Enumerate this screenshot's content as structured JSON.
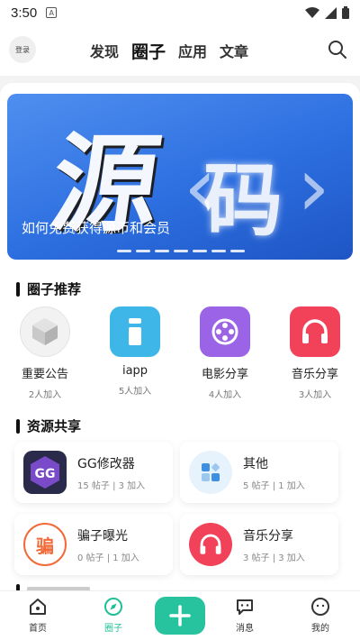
{
  "status": {
    "time": "3:50"
  },
  "header": {
    "login_label": "登录",
    "tabs": [
      {
        "label": "发现"
      },
      {
        "label": "圈子"
      },
      {
        "label": "应用"
      },
      {
        "label": "文章"
      }
    ],
    "active_tab": "圈子"
  },
  "banner": {
    "caption": "如何免费获得源币和会员",
    "art_text_1": "源",
    "art_text_2": "码",
    "dots": 7
  },
  "recommend": {
    "title": "圈子推荐",
    "items": [
      {
        "name": "重要公告",
        "members": "2人加入",
        "icon": "cube-icon"
      },
      {
        "name": "iapp",
        "members": "5人加入",
        "icon": "info-i-icon"
      },
      {
        "name": "电影分享",
        "members": "4人加入",
        "icon": "film-reel-icon"
      },
      {
        "name": "音乐分享",
        "members": "3人加入",
        "icon": "headphones-icon"
      }
    ]
  },
  "resources": {
    "title": "资源共享",
    "cards": [
      {
        "title": "GG修改器",
        "stats": "15 帖子 | 3 加入",
        "icon": "gg-logo-icon"
      },
      {
        "title": "其他",
        "stats": "5 帖子 | 1 加入",
        "icon": "grid-icon"
      },
      {
        "title": "骗子曝光",
        "stats": "0 帖子 | 1 加入",
        "icon": "scam-badge-icon",
        "icon_text": "骗"
      },
      {
        "title": "音乐分享",
        "stats": "3 帖子 | 3 加入",
        "icon": "headphones-icon"
      }
    ]
  },
  "bottom_nav": {
    "items": [
      {
        "label": "首页",
        "icon": "home-icon"
      },
      {
        "label": "圈子",
        "icon": "compass-icon"
      },
      {
        "label": "消息",
        "icon": "chat-icon"
      },
      {
        "label": "我的",
        "icon": "profile-icon"
      }
    ],
    "active": "圈子"
  },
  "colors": {
    "accent": "#27c29e",
    "banner_blue": "#3a7be6",
    "music_red": "#f1425a",
    "film_purple": "#9b63e6",
    "iapp_blue": "#3fb6e8"
  }
}
